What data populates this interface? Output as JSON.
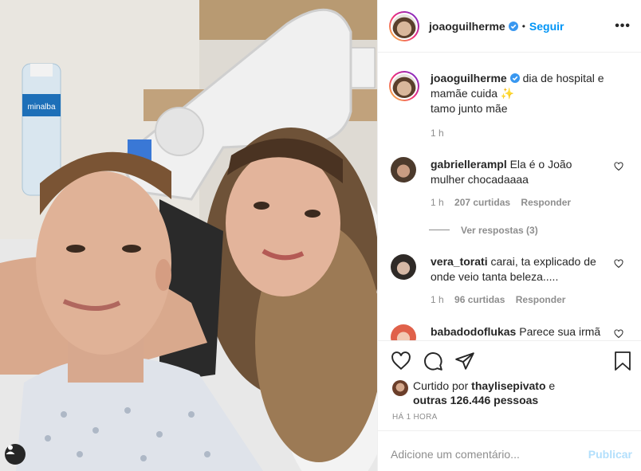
{
  "post": {
    "username": "joaoguilherme",
    "follow_label": "Seguir",
    "dot": "•",
    "more": "•••"
  },
  "caption": {
    "username": "joaoguilherme",
    "text": "dia de hospital e mamãe cuida ✨",
    "line2": "tamo junto mãe",
    "time": "1 h"
  },
  "comments": [
    {
      "username": "gabriellerampl",
      "text": "Ela é o João mulher chocadaaaa",
      "time": "1 h",
      "likes": "207 curtidas",
      "reply": "Responder",
      "view_replies": "Ver respostas (3)"
    },
    {
      "username": "vera_torati",
      "text": "carai, ta explicado de onde veio tanta beleza.....",
      "time": "1 h",
      "likes": "96 curtidas",
      "reply": "Responder"
    },
    {
      "username": "babadodoflukas",
      "text": "Parece sua irmã"
    }
  ],
  "likes": {
    "prefix": "Curtido por",
    "user": "thaylisepivato",
    "suffix": "e",
    "others": "outras 126.446 pessoas"
  },
  "timestamp": "HÁ 1 HORA",
  "add_comment": {
    "placeholder": "Adicione um comentário...",
    "publish": "Publicar"
  },
  "photo": {
    "bottle_label": "minalba"
  },
  "colors": {
    "accent": "#0095f6",
    "muted": "#8e8e8e",
    "publish_disabled": "#b2dffc"
  }
}
